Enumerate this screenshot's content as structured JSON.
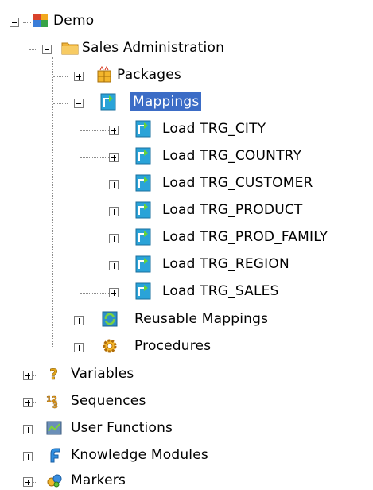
{
  "tree": {
    "root": {
      "label": "Demo",
      "icon": "project-icon",
      "expanded": true
    },
    "folder": {
      "label": "Sales Administration",
      "icon": "folder-icon",
      "expanded": true
    },
    "packages": {
      "label": "Packages",
      "icon": "package-icon",
      "expanded": false
    },
    "mappings": {
      "label": "Mappings",
      "icon": "mapping-icon",
      "expanded": true,
      "selected": true
    },
    "mapping_items": [
      {
        "label": "Load TRG_CITY",
        "icon": "mapping-icon"
      },
      {
        "label": "Load TRG_COUNTRY",
        "icon": "mapping-icon"
      },
      {
        "label": "Load TRG_CUSTOMER",
        "icon": "mapping-icon"
      },
      {
        "label": "Load TRG_PRODUCT",
        "icon": "mapping-icon"
      },
      {
        "label": "Load TRG_PROD_FAMILY",
        "icon": "mapping-icon"
      },
      {
        "label": "Load TRG_REGION",
        "icon": "mapping-icon"
      },
      {
        "label": "Load TRG_SALES",
        "icon": "mapping-icon"
      }
    ],
    "reusable_mappings": {
      "label": "Reusable Mappings",
      "icon": "reusable-mapping-icon"
    },
    "procedures": {
      "label": "Procedures",
      "icon": "procedure-gear-icon"
    },
    "variables": {
      "label": "Variables",
      "icon": "variable-question-icon"
    },
    "sequences": {
      "label": "Sequences",
      "icon": "sequence-123-icon"
    },
    "user_functions": {
      "label": "User Functions",
      "icon": "user-function-icon"
    },
    "knowledge_modules": {
      "label": "Knowledge Modules",
      "icon": "knowledge-module-icon"
    },
    "markers": {
      "label": "Markers",
      "icon": "marker-icon"
    }
  },
  "colors": {
    "selection": "#3b6cc6",
    "tree_line": "#8c8c8c"
  }
}
